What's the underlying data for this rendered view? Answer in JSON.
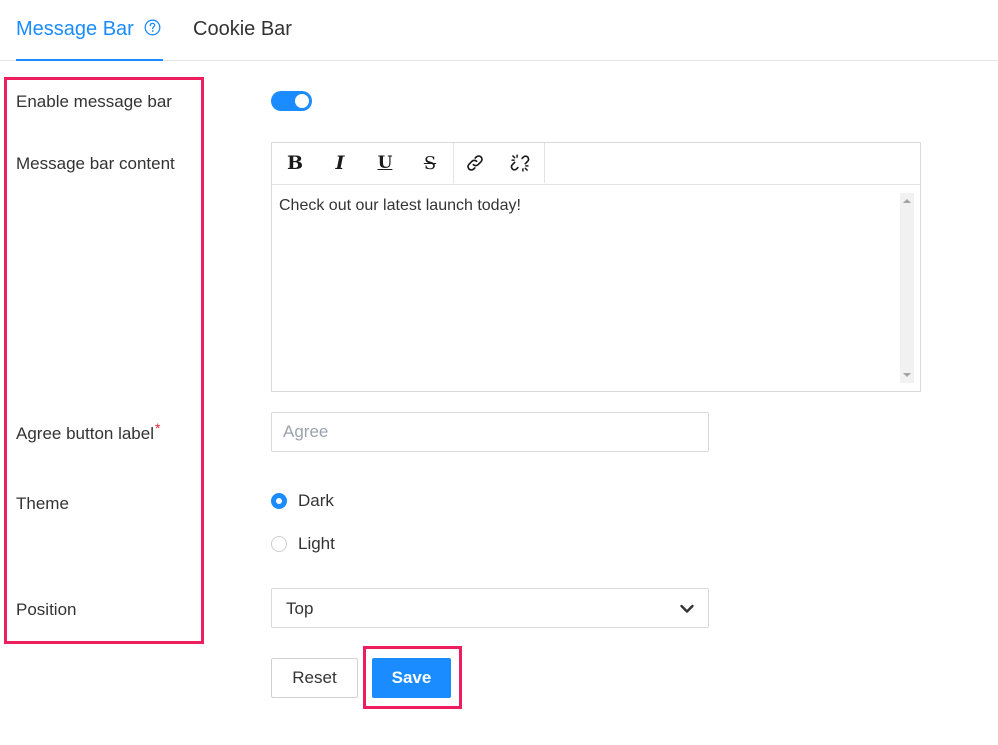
{
  "tabs": [
    {
      "label": "Message Bar",
      "active": true
    },
    {
      "label": "Cookie Bar",
      "active": false
    }
  ],
  "form": {
    "enable_label": "Enable message bar",
    "enable_on": true,
    "content_label": "Message bar content",
    "content_value": "Check out our latest launch today!",
    "agree_label": "Agree button label",
    "agree_required_mark": "*",
    "agree_placeholder": "Agree",
    "theme_label": "Theme",
    "theme_options": [
      "Dark",
      "Light"
    ],
    "theme_selected": "Dark",
    "position_label": "Position",
    "position_value": "Top"
  },
  "toolbar": {
    "bold": "B",
    "italic": "I",
    "underline": "U",
    "strike": "S",
    "link_icon": "link-icon",
    "unlink_icon": "unlink-icon"
  },
  "actions": {
    "reset_label": "Reset",
    "save_label": "Save"
  },
  "colors": {
    "accent": "#1a8cff",
    "highlight": "#ee1d5e",
    "required": "#e8213b"
  }
}
